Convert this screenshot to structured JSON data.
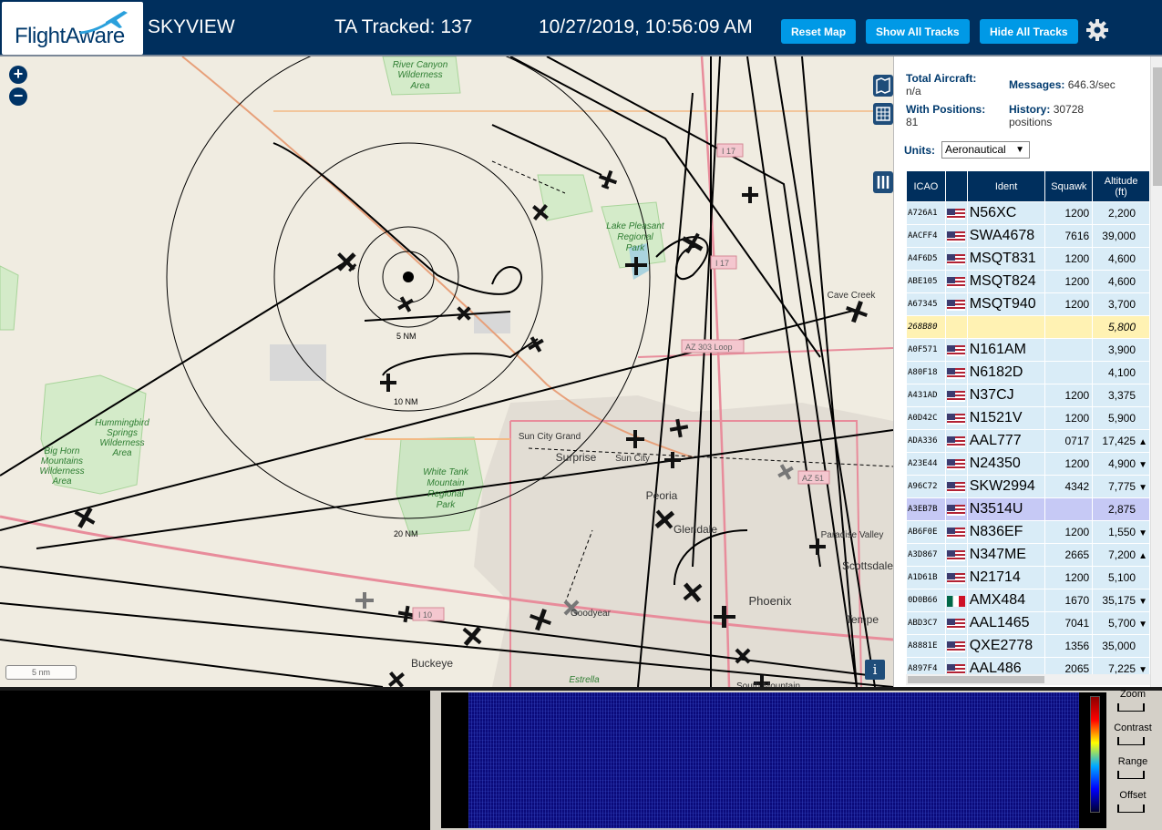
{
  "header": {
    "logo_text": "FlightAware",
    "title": "SKYVIEW",
    "tracked": "TA Tracked: 137",
    "timestamp": "10/27/2019, 10:56:09 AM",
    "reset_label": "Reset Map",
    "show_label": "Show All Tracks",
    "hide_label": "Hide All Tracks"
  },
  "map": {
    "zoom_in": "+",
    "zoom_out": "−",
    "scale": "5 nm",
    "info": "i",
    "range_rings": [
      "5 NM",
      "10 NM",
      "20 NM"
    ],
    "places": [
      {
        "name": "River Canyon\nWilderness\nArea"
      },
      {
        "name": "Lake Pleasant\nRegional\nPark"
      },
      {
        "name": "Cave Creek"
      },
      {
        "name": "Hummingbird\nSprings\nWilderness\nArea"
      },
      {
        "name": "Big Horn\nMountains\nWilderness\nArea"
      },
      {
        "name": "White Tank\nMountain\nRegional\nPark"
      },
      {
        "name": "Sun City Grand"
      },
      {
        "name": "Surprise"
      },
      {
        "name": "Sun City"
      },
      {
        "name": "Peoria"
      },
      {
        "name": "Glendale"
      },
      {
        "name": "Paradise Valley"
      },
      {
        "name": "Scottsdale"
      },
      {
        "name": "Phoenix"
      },
      {
        "name": "Tempe"
      },
      {
        "name": "Buckeye"
      },
      {
        "name": "Estrella"
      },
      {
        "name": "Goodyear"
      },
      {
        "name": "South Mountain"
      }
    ],
    "highways": [
      "I 17",
      "I 17",
      "AZ 303 Loop",
      "AZ 51",
      "I 10"
    ]
  },
  "stats": {
    "total_label": "Total Aircraft:",
    "total_value": "n/a",
    "positions_label": "With Positions:",
    "positions_value": "81",
    "messages_label": "Messages:",
    "messages_value": "646.3/sec",
    "history_label": "History:",
    "history_value": "30728",
    "history_unit": "positions"
  },
  "units": {
    "label": "Units:",
    "selected": "Aeronautical"
  },
  "table": {
    "headers": [
      "ICAO",
      "",
      "Ident",
      "Squawk",
      "Altitude (ft)"
    ],
    "header_alt_line1": "Altitude",
    "header_alt_line2": "(ft)",
    "rows": [
      {
        "icao": "A726A1",
        "flag": "us",
        "ident": "N56XC",
        "squawk": "1200",
        "alt": "2,200",
        "trend": ""
      },
      {
        "icao": "AACFF4",
        "flag": "us",
        "ident": "SWA4678",
        "squawk": "7616",
        "alt": "39,000",
        "trend": ""
      },
      {
        "icao": "A4F6D5",
        "flag": "us",
        "ident": "MSQT831",
        "squawk": "1200",
        "alt": "4,600",
        "trend": ""
      },
      {
        "icao": "ABE105",
        "flag": "us",
        "ident": "MSQT824",
        "squawk": "1200",
        "alt": "4,600",
        "trend": ""
      },
      {
        "icao": "A67345",
        "flag": "us",
        "ident": "MSQT940",
        "squawk": "1200",
        "alt": "3,700",
        "trend": ""
      },
      {
        "icao": "268B80",
        "flag": "",
        "ident": "",
        "squawk": "",
        "alt": "5,800",
        "trend": "",
        "state": "pending"
      },
      {
        "icao": "A0F571",
        "flag": "us",
        "ident": "N161AM",
        "squawk": "",
        "alt": "3,900",
        "trend": ""
      },
      {
        "icao": "A80F18",
        "flag": "us",
        "ident": "N6182D",
        "squawk": "",
        "alt": "4,100",
        "trend": ""
      },
      {
        "icao": "A431AD",
        "flag": "us",
        "ident": "N37CJ",
        "squawk": "1200",
        "alt": "3,375",
        "trend": ""
      },
      {
        "icao": "A0D42C",
        "flag": "us",
        "ident": "N1521V",
        "squawk": "1200",
        "alt": "5,900",
        "trend": ""
      },
      {
        "icao": "ADA336",
        "flag": "us",
        "ident": "AAL777",
        "squawk": "0717",
        "alt": "17,425",
        "trend": "▲"
      },
      {
        "icao": "A23E44",
        "flag": "us",
        "ident": "N24350",
        "squawk": "1200",
        "alt": "4,900",
        "trend": "▼"
      },
      {
        "icao": "A96C72",
        "flag": "us",
        "ident": "SKW2994",
        "squawk": "4342",
        "alt": "7,775",
        "trend": "▼"
      },
      {
        "icao": "A3EB7B",
        "flag": "us",
        "ident": "N3514U",
        "squawk": "",
        "alt": "2,875",
        "trend": "",
        "state": "selected"
      },
      {
        "icao": "AB6F0E",
        "flag": "us",
        "ident": "N836EF",
        "squawk": "1200",
        "alt": "1,550",
        "trend": "▼"
      },
      {
        "icao": "A3D867",
        "flag": "us",
        "ident": "N347ME",
        "squawk": "2665",
        "alt": "7,200",
        "trend": "▲"
      },
      {
        "icao": "A1D61B",
        "flag": "us",
        "ident": "N21714",
        "squawk": "1200",
        "alt": "5,100",
        "trend": ""
      },
      {
        "icao": "0D0B66",
        "flag": "mx",
        "ident": "AMX484",
        "squawk": "1670",
        "alt": "35,175",
        "trend": "▼"
      },
      {
        "icao": "ABD3C7",
        "flag": "us",
        "ident": "AAL1465",
        "squawk": "7041",
        "alt": "5,700",
        "trend": "▼"
      },
      {
        "icao": "A8881E",
        "flag": "us",
        "ident": "QXE2778",
        "squawk": "1356",
        "alt": "35,000",
        "trend": ""
      },
      {
        "icao": "A897F4",
        "flag": "us",
        "ident": "AAL486",
        "squawk": "2065",
        "alt": "7,225",
        "trend": "▼"
      }
    ]
  },
  "spectrum": {
    "zoom_label": "Zoom",
    "contrast_label": "Contrast",
    "range_label": "Range",
    "offset_label": "Offset"
  }
}
